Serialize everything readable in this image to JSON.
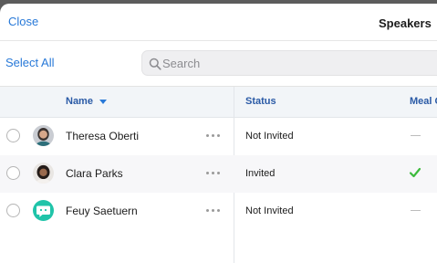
{
  "header": {
    "close_label": "Close",
    "title": "Speakers"
  },
  "toolbar": {
    "select_all_label": "Select All",
    "search_placeholder": "Search"
  },
  "table": {
    "columns": {
      "name": "Name",
      "status": "Status",
      "meal": "Meal C"
    },
    "sort": {
      "column": "name",
      "direction": "descending",
      "icon": "caret-down-icon"
    },
    "rows": [
      {
        "name": "Theresa Oberti",
        "status": "Not Invited",
        "meal": "—",
        "avatar": "photo-avatar",
        "selected": false
      },
      {
        "name": "Clara Parks",
        "status": "Invited",
        "meal": "checkmark",
        "avatar": "photo-avatar",
        "selected": false
      },
      {
        "name": "Feuy Saetuern",
        "status": "Not Invited",
        "meal": "—",
        "avatar": "placeholder-avatar",
        "selected": false
      }
    ]
  },
  "colors": {
    "accent": "#2879d8",
    "header_text": "#2a5aa6",
    "check": "#3dbb3d",
    "placeholder_avatar": "#20c4a9"
  }
}
